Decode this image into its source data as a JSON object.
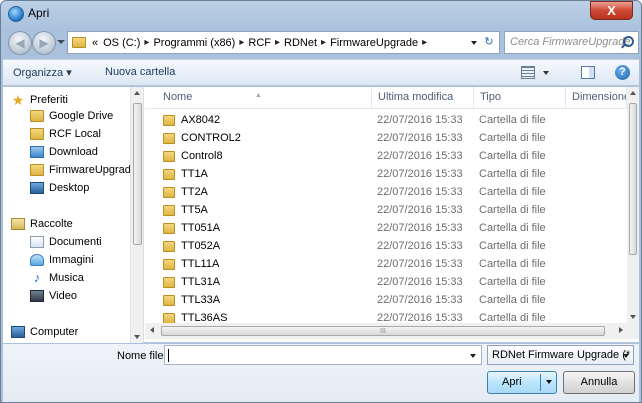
{
  "window": {
    "title": "Apri",
    "close_label": "X"
  },
  "nav": {
    "back_icon": "back-arrow-icon",
    "forward_icon": "forward-arrow-icon"
  },
  "address": {
    "prefix": "«",
    "crumbs": [
      "OS (C:)",
      "Programmi (x86)",
      "RCF",
      "RDNet",
      "FirmwareUpgrade"
    ],
    "separator": "▸"
  },
  "search": {
    "placeholder": "Cerca FirmwareUpgrade"
  },
  "toolbar": {
    "organize_label": "Organizza ▾",
    "new_folder_label": "Nuova cartella",
    "help_label": "?"
  },
  "sidebar": {
    "items": [
      {
        "label": "Preferiti",
        "icon": "star-icon"
      },
      {
        "label": "Google Drive",
        "icon": "folder-icon"
      },
      {
        "label": "RCF Local",
        "icon": "folder-icon"
      },
      {
        "label": "Download",
        "icon": "download-folder-icon"
      },
      {
        "label": "FirmwareUpgrade",
        "icon": "folder-icon"
      },
      {
        "label": "Desktop",
        "icon": "desktop-icon"
      },
      {
        "label": "Raccolte",
        "icon": "library-icon"
      },
      {
        "label": "Documenti",
        "icon": "documents-icon"
      },
      {
        "label": "Immagini",
        "icon": "pictures-icon"
      },
      {
        "label": "Musica",
        "icon": "music-icon"
      },
      {
        "label": "Video",
        "icon": "video-icon"
      },
      {
        "label": "Computer",
        "icon": "computer-icon"
      }
    ]
  },
  "files": {
    "columns": [
      "Nome",
      "Ultima modifica",
      "Tipo",
      "Dimensione"
    ],
    "rows": [
      {
        "name": "AX8042",
        "date": "22/07/2016 15:33",
        "type": "Cartella di file"
      },
      {
        "name": "CONTROL2",
        "date": "22/07/2016 15:33",
        "type": "Cartella di file"
      },
      {
        "name": "Control8",
        "date": "22/07/2016 15:33",
        "type": "Cartella di file"
      },
      {
        "name": "TT1A",
        "date": "22/07/2016 15:33",
        "type": "Cartella di file"
      },
      {
        "name": "TT2A",
        "date": "22/07/2016 15:33",
        "type": "Cartella di file"
      },
      {
        "name": "TT5A",
        "date": "22/07/2016 15:33",
        "type": "Cartella di file"
      },
      {
        "name": "TT051A",
        "date": "22/07/2016 15:33",
        "type": "Cartella di file"
      },
      {
        "name": "TT052A",
        "date": "22/07/2016 15:33",
        "type": "Cartella di file"
      },
      {
        "name": "TTL11A",
        "date": "22/07/2016 15:33",
        "type": "Cartella di file"
      },
      {
        "name": "TTL31A",
        "date": "22/07/2016 15:33",
        "type": "Cartella di file"
      },
      {
        "name": "TTL33A",
        "date": "22/07/2016 15:33",
        "type": "Cartella di file"
      },
      {
        "name": "TTL36AS",
        "date": "22/07/2016 15:33",
        "type": "Cartella di file"
      }
    ]
  },
  "footer": {
    "filename_label": "Nome file:",
    "filename_value": "",
    "filter_value": "RDNet Firmware Upgrade (*",
    "open_label": "Apri",
    "cancel_label": "Annulla"
  }
}
